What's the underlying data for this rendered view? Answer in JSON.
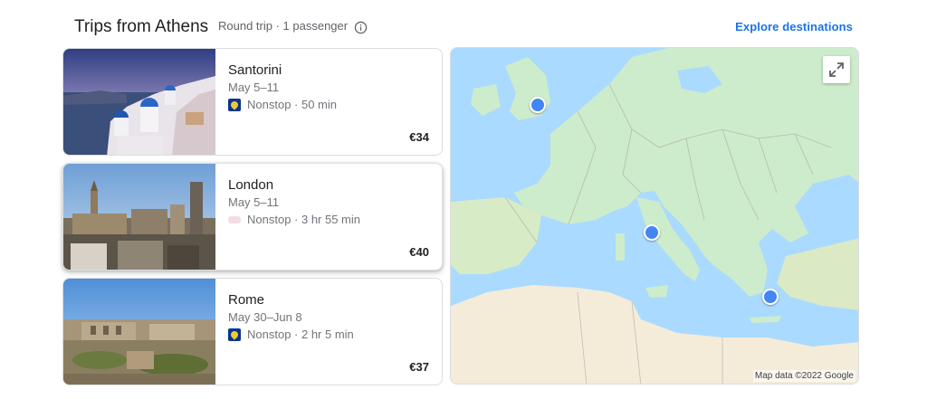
{
  "header": {
    "title": "Trips from Athens",
    "subtitle": "Round trip · 1 passenger",
    "explore_link": "Explore destinations"
  },
  "trips": [
    {
      "destination": "Santorini",
      "dates": "May 5–11",
      "flight": "Nonstop · 50 min",
      "price": "€34",
      "airline_icon": "ryanair-logo-icon"
    },
    {
      "destination": "London",
      "dates": "May 5–11",
      "flight": "Nonstop · 3 hr 55 min",
      "price": "€40",
      "airline_icon": "airline-logo-icon"
    },
    {
      "destination": "Rome",
      "dates": "May 30–Jun 8",
      "flight": "Nonstop · 2 hr 5 min",
      "price": "€37",
      "airline_icon": "ryanair-logo-icon"
    }
  ],
  "map": {
    "credit": "Map data ©2022 Google",
    "pins": [
      "London",
      "Rome",
      "Santorini"
    ]
  },
  "colors": {
    "accent": "#1a73e8",
    "pin": "#4285f4",
    "water": "#aadaff",
    "land": "#cdeccb"
  }
}
